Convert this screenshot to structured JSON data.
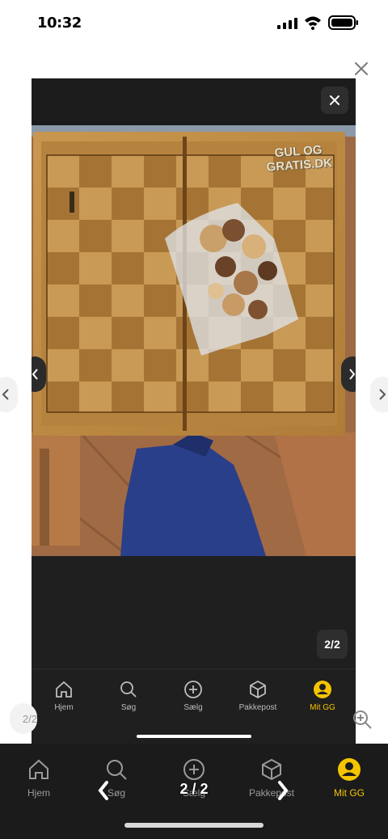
{
  "status_bar": {
    "time": "10:32",
    "icons": [
      "signal-icon",
      "wifi-icon",
      "battery-icon"
    ]
  },
  "viewer": {
    "watermark_line1": "GUL OG",
    "watermark_line2": "GRATIS.DK",
    "counter": "2/2",
    "image_description_icon": "chessboard-photo"
  },
  "background_page": {
    "pager_text": "2/2",
    "zoom_icon": "zoom-icon"
  },
  "inner_tabbar": {
    "tabs": [
      {
        "label": "Hjem",
        "icon": "home-icon"
      },
      {
        "label": "Søg",
        "icon": "search-icon"
      },
      {
        "label": "Sælg",
        "icon": "plus-circle-icon"
      },
      {
        "label": "Pakkepost",
        "icon": "package-icon"
      },
      {
        "label": "Mit GG",
        "icon": "profile-icon",
        "active": true
      }
    ]
  },
  "outer_tabbar": {
    "tabs": [
      {
        "label": "Hjem",
        "icon": "home-icon"
      },
      {
        "label": "Søg",
        "icon": "search-icon"
      },
      {
        "label": "Sælg",
        "icon": "plus-circle-icon"
      },
      {
        "label": "Pakkepost",
        "icon": "package-icon"
      },
      {
        "label": "Mit GG",
        "icon": "profile-icon",
        "active": true
      }
    ],
    "pager_text": "2 / 2"
  },
  "colors": {
    "accent": "#f5c400",
    "modal_bg": "#1f1f1f",
    "tabbar_bg": "#1b1b1b"
  }
}
